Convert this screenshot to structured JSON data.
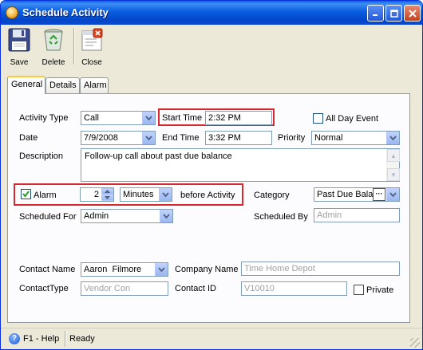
{
  "window": {
    "title": "Schedule Activity"
  },
  "toolbar": {
    "save": "Save",
    "delete": "Delete",
    "close": "Close"
  },
  "tabs": [
    "General",
    "Details",
    "Alarm"
  ],
  "form": {
    "activity_type": {
      "label": "Activity Type",
      "value": "Call"
    },
    "start_time": {
      "label": "Start Time",
      "value": "2:32 PM"
    },
    "all_day": {
      "label": "All Day Event",
      "checked": false
    },
    "date": {
      "label": "Date",
      "value": "7/9/2008"
    },
    "end_time": {
      "label": "End Time",
      "value": "3:32 PM"
    },
    "priority": {
      "label": "Priority",
      "value": "Normal"
    },
    "description": {
      "label": "Description",
      "value": "Follow-up call about past due balance"
    },
    "alarm": {
      "label": "Alarm",
      "checked": true,
      "count": "2",
      "unit": "Minutes",
      "suffix": "before Activity"
    },
    "category": {
      "label": "Category",
      "value": "Past Due Balar"
    },
    "scheduled_for": {
      "label": "Scheduled For",
      "value": "Admin"
    },
    "scheduled_by": {
      "label": "Scheduled By",
      "value": "Admin"
    },
    "contact_name": {
      "label": "Contact Name",
      "value": "Aaron  Filmore"
    },
    "company_name": {
      "label": "Company Name",
      "value": "Time Home Depot"
    },
    "contact_type": {
      "label": "ContactType",
      "value": "Vendor Con"
    },
    "contact_id": {
      "label": "Contact ID",
      "value": "V10010"
    },
    "private": {
      "label": "Private",
      "checked": false
    }
  },
  "status": {
    "help": "F1 - Help",
    "state": "Ready"
  }
}
